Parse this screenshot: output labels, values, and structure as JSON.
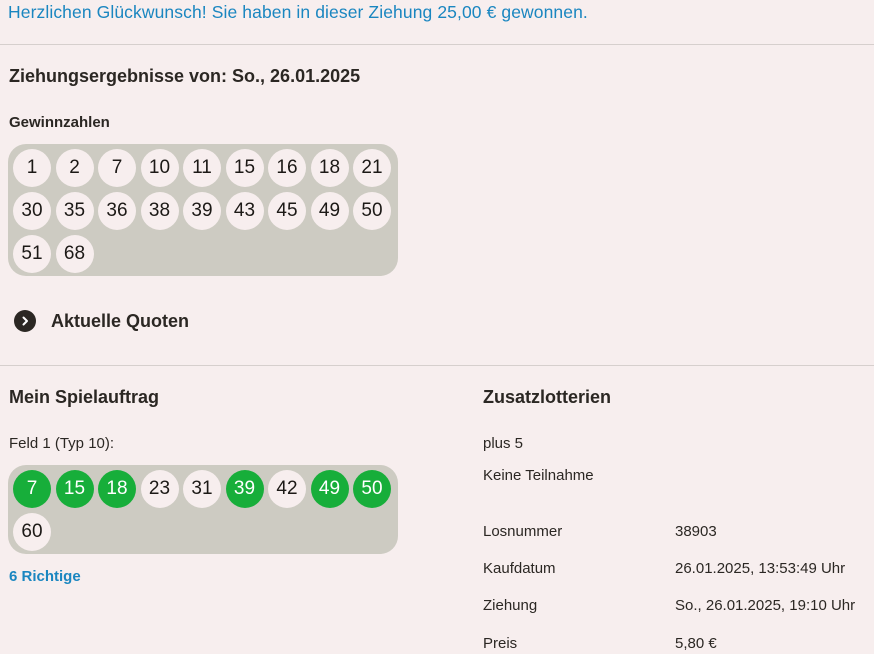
{
  "banner": "Herzlichen Glückwunsch! Sie haben in dieser Ziehung 25,00 € gewonnen.",
  "results": {
    "heading": "Ziehungsergebnisse von: So., 26.01.2025",
    "winning_label": "Gewinnzahlen",
    "numbers": [
      "1",
      "2",
      "7",
      "10",
      "11",
      "15",
      "16",
      "18",
      "21",
      "30",
      "35",
      "36",
      "38",
      "39",
      "43",
      "45",
      "49",
      "50",
      "51",
      "68"
    ],
    "quotes_link": "Aktuelle Quoten",
    "quotes_icon": "chevron-right-icon"
  },
  "ticket": {
    "heading": "Mein Spielauftrag",
    "field_label": "Feld 1 (Typ 10):",
    "numbers": [
      {
        "n": "7",
        "hit": true
      },
      {
        "n": "15",
        "hit": true
      },
      {
        "n": "18",
        "hit": true
      },
      {
        "n": "23",
        "hit": false
      },
      {
        "n": "31",
        "hit": false
      },
      {
        "n": "39",
        "hit": true
      },
      {
        "n": "42",
        "hit": false
      },
      {
        "n": "49",
        "hit": true
      },
      {
        "n": "50",
        "hit": true
      },
      {
        "n": "60",
        "hit": false
      }
    ],
    "correct": "6 Richtige"
  },
  "extra": {
    "heading": "Zusatzlotterien",
    "name": "plus 5",
    "status": "Keine Teilnahme",
    "details": [
      {
        "label": "Losnummer",
        "value": "38903"
      },
      {
        "label": "Kaufdatum",
        "value": "26.01.2025, 13:53:49 Uhr"
      },
      {
        "label": "Ziehung",
        "value": "So., 26.01.2025, 19:10 Uhr"
      },
      {
        "label": "Preis",
        "value": "5,80 €"
      }
    ]
  },
  "colors": {
    "accent": "#1a86c0",
    "hit": "#17ae3a",
    "background": "#f7eeee",
    "ball_box": "#cdcbc2"
  }
}
